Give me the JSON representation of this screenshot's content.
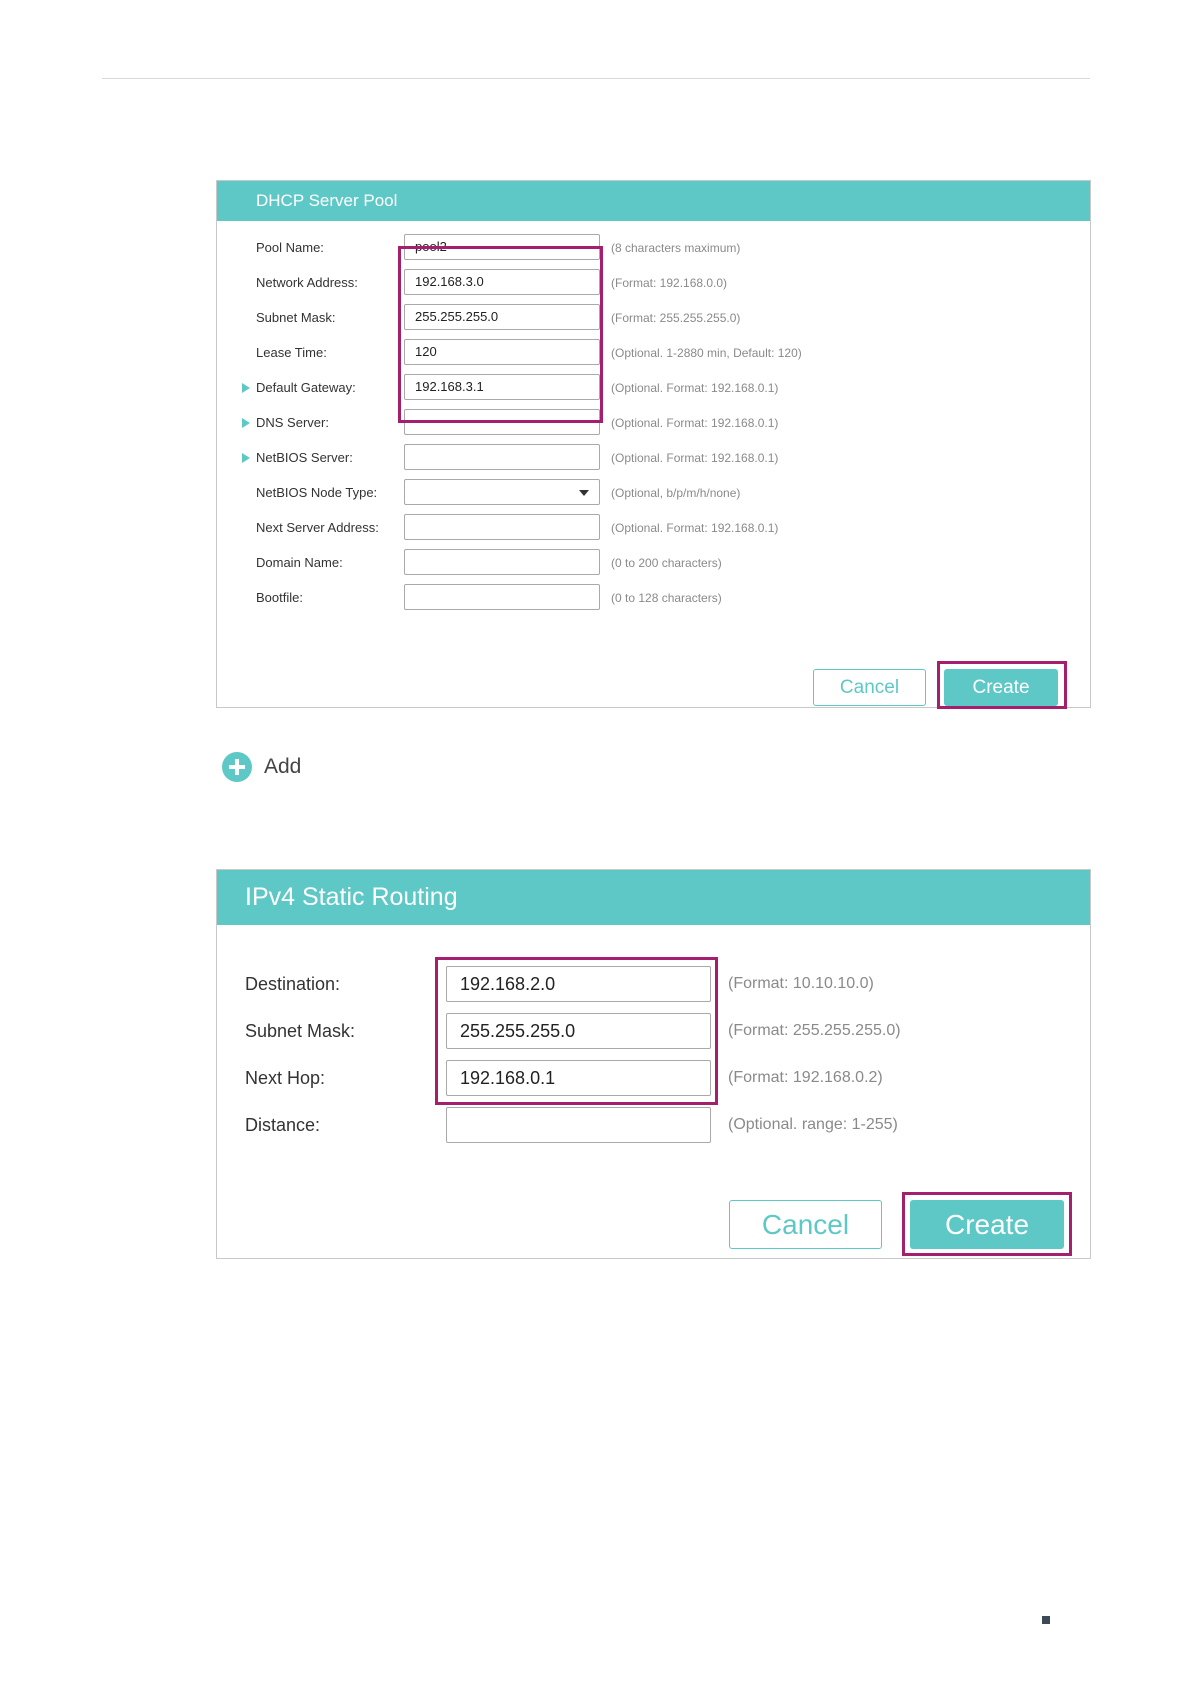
{
  "dhcp": {
    "title": "DHCP Server Pool",
    "fields": [
      {
        "label": "Pool Name:",
        "value": "pool2",
        "hint": "(8 characters maximum)",
        "expandable": false
      },
      {
        "label": "Network Address:",
        "value": "192.168.3.0",
        "hint": "(Format: 192.168.0.0)",
        "expandable": false
      },
      {
        "label": "Subnet Mask:",
        "value": "255.255.255.0",
        "hint": "(Format: 255.255.255.0)",
        "expandable": false
      },
      {
        "label": "Lease Time:",
        "value": "120",
        "hint": "(Optional. 1-2880 min, Default: 120)",
        "expandable": false
      },
      {
        "label": "Default Gateway:",
        "value": "192.168.3.1",
        "hint": "(Optional. Format: 192.168.0.1)",
        "expandable": true
      },
      {
        "label": "DNS Server:",
        "value": "",
        "hint": "(Optional. Format: 192.168.0.1)",
        "expandable": true
      },
      {
        "label": "NetBIOS Server:",
        "value": "",
        "hint": "(Optional. Format: 192.168.0.1)",
        "expandable": true
      },
      {
        "label": "NetBIOS Node Type:",
        "value": "",
        "hint": "(Optional, b/p/m/h/none)",
        "expandable": false
      },
      {
        "label": "Next Server Address:",
        "value": "",
        "hint": "(Optional. Format: 192.168.0.1)",
        "expandable": false
      },
      {
        "label": "Domain Name:",
        "value": "",
        "hint": "(0 to 200 characters)",
        "expandable": false
      },
      {
        "label": "Bootfile:",
        "value": "",
        "hint": "(0 to 128 characters)",
        "expandable": false
      }
    ],
    "cancel_label": "Cancel",
    "create_label": "Create"
  },
  "add": {
    "label": "Add",
    "icon": "plus-circle-icon"
  },
  "routing": {
    "title": "IPv4 Static Routing",
    "fields": [
      {
        "label": "Destination:",
        "value": "192.168.2.0",
        "hint": "(Format: 10.10.10.0)"
      },
      {
        "label": "Subnet Mask:",
        "value": "255.255.255.0",
        "hint": "(Format: 255.255.255.0)"
      },
      {
        "label": "Next Hop:",
        "value": "192.168.0.1",
        "hint": "(Format: 192.168.0.2)"
      },
      {
        "label": "Distance:",
        "value": "",
        "hint": "(Optional. range: 1-255)"
      }
    ],
    "cancel_label": "Cancel",
    "create_label": "Create"
  },
  "colors": {
    "accent": "#5ec8c6",
    "highlight": "#a4206e",
    "hint": "#8a8a8a"
  }
}
